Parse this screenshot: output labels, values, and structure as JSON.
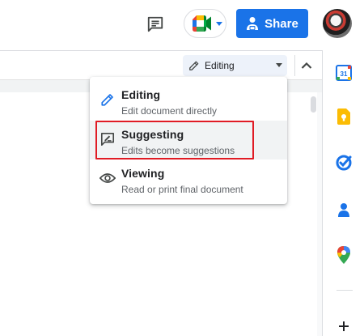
{
  "header": {
    "share_label": "Share",
    "icons": {
      "comment": "comment-icon",
      "meet": "google-meet-icon",
      "share": "share-person-icon"
    }
  },
  "toolbar": {
    "mode_label": "Editing",
    "mode_icon": "pencil-icon",
    "collapse_icon": "chevron-up-icon"
  },
  "mode_menu": {
    "items": [
      {
        "title": "Editing",
        "description": "Edit document directly",
        "icon": "pencil-icon"
      },
      {
        "title": "Suggesting",
        "description": "Edits become suggestions",
        "icon": "suggest-edit-icon",
        "highlighted": true
      },
      {
        "title": "Viewing",
        "description": "Read or print final document",
        "icon": "eye-icon"
      }
    ]
  },
  "side_panel": {
    "apps": [
      "calendar-icon",
      "keep-icon",
      "tasks-icon",
      "contacts-icon",
      "maps-icon"
    ],
    "calendar_day": "31",
    "add_icon": "plus-icon"
  },
  "colors": {
    "accent": "#1a73e8",
    "highlight_border": "#e01b24"
  }
}
